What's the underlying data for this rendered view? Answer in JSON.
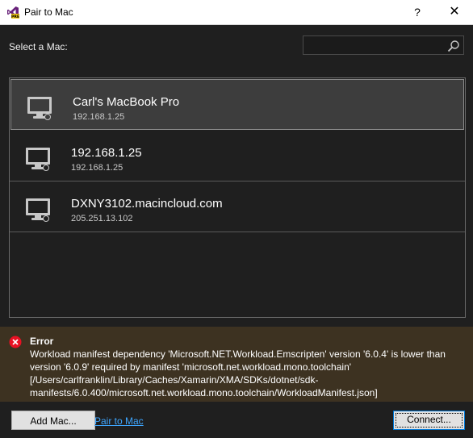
{
  "window": {
    "title": "Pair to Mac",
    "help": "?",
    "close": "✕",
    "app_icon": "visual-studio-preview-icon"
  },
  "header": {
    "select_label": "Select a Mac:",
    "search": {
      "value": "",
      "placeholder": "",
      "icon": "search-icon"
    }
  },
  "macs": [
    {
      "name": "Carl's MacBook Pro",
      "address": "192.168.1.25",
      "selected": true,
      "icon": "mac-computer-icon"
    },
    {
      "name": "192.168.1.25",
      "address": "192.168.1.25",
      "selected": false,
      "icon": "mac-computer-icon"
    },
    {
      "name": "DXNY3102.macincloud.com",
      "address": "205.251.13.102",
      "selected": false,
      "icon": "mac-computer-icon"
    }
  ],
  "error": {
    "title": "Error",
    "message": "Workload manifest dependency 'Microsoft.NET.Workload.Emscripten' version '6.0.4' is lower than version '6.0.9' required by manifest 'microsoft.net.workload.mono.toolchain' [/Users/carlfranklin/Library/Caches/Xamarin/XMA/SDKs/dotnet/sdk-manifests/6.0.400/microsoft.net.workload.mono.toolchain/WorkloadManifest.json]",
    "icon": "error-icon"
  },
  "footer": {
    "add_mac": "Add Mac...",
    "pair_link": "Pair to Mac",
    "connect": "Connect..."
  },
  "colors": {
    "background": "#1f1f1f",
    "selected_row": "#3d3d3d",
    "error_panel": "#3d3221",
    "error_red": "#e81123",
    "link": "#3ea6ff",
    "vs_purple": "#68217a"
  }
}
